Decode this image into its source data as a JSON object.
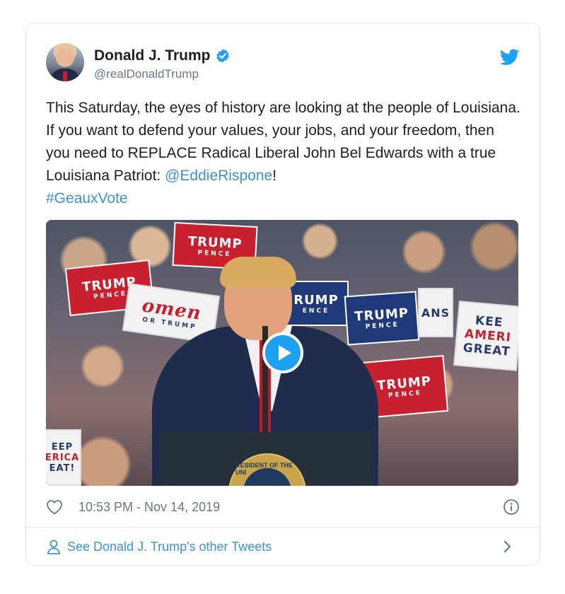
{
  "tweet": {
    "author_name": "Donald J. Trump",
    "handle": "@realDonaldTrump",
    "text_before": "This Saturday, the eyes of history are looking at the people of Louisiana. If you want to defend your values, your jobs, and your freedom, then you need to REPLACE Radical Liberal John Bel Edwards with a true Louisiana Patriot: ",
    "mention": "@EddieRispone",
    "text_after": "!",
    "hashtag": "#GeauxVote",
    "timestamp": "10:53 PM - Nov 14, 2019",
    "footer_link": "See Donald J. Trump's other Tweets"
  },
  "media": {
    "signs": {
      "trump": "TRUMP",
      "pence": "PENCE",
      "trump_partial": "RUMP",
      "pence_partial": "ENCE",
      "women": "omen",
      "for_trump": "OR TRUMP",
      "keep_america_great_1": "KEE",
      "keep_america_great_2": "AMERI",
      "keep_america_great_3": "GREAT",
      "left_1": "EEP",
      "left_2": "ERICA",
      "left_3": "EAT!",
      "ans": "ANS",
      "seal_text": "RESIDENT OF THE UNI"
    }
  },
  "colors": {
    "link": "#3b94d9",
    "twitter_blue": "#1da1f2",
    "muted": "#697882",
    "border": "#e1e8ed"
  },
  "icons": {
    "verified": "verified-badge-icon",
    "bird": "twitter-bird-icon",
    "play": "play-icon",
    "heart": "heart-icon",
    "info": "info-icon",
    "person": "person-icon",
    "chevron": "chevron-right-icon"
  }
}
